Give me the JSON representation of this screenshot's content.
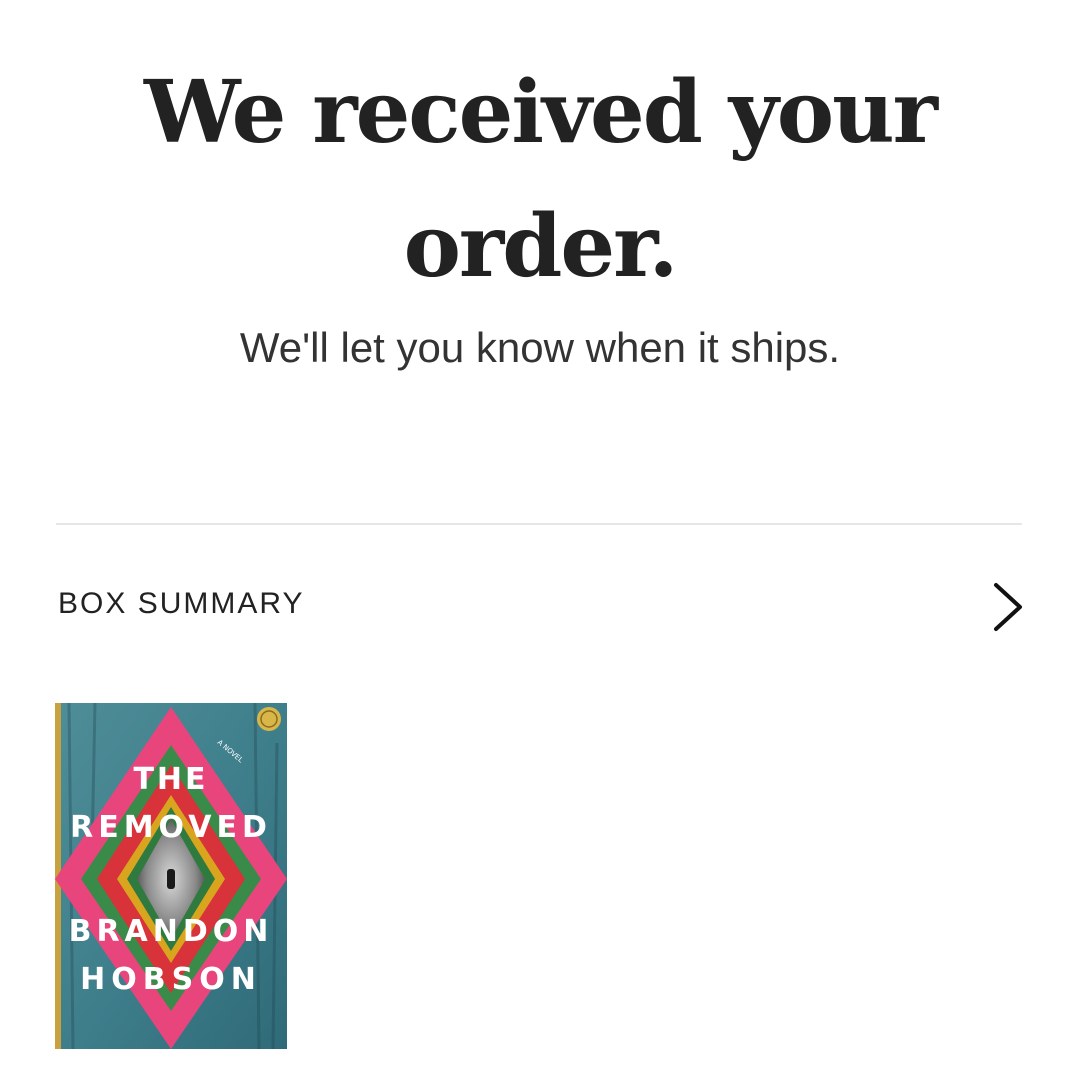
{
  "confirmation": {
    "title_line1": "We received your",
    "title_line2": "order.",
    "subtitle": "We'll let you know when it ships."
  },
  "box_summary": {
    "label": "BOX SUMMARY",
    "chevron_icon": "chevron-right-icon"
  },
  "books": [
    {
      "cover_title_line1": "THE",
      "cover_title_line2": "REMOVED",
      "cover_author_line1": "BRANDON",
      "cover_author_line2": "HOBSON",
      "cover_tagline": "A NOVEL",
      "badge_icon": "book-of-the-month-badge-icon"
    }
  ],
  "colors": {
    "text": "#222222",
    "divider": "#e6e6e6",
    "cover_teal": "#3f7f8c",
    "cover_pink": "#e8457d",
    "cover_red": "#d8323a",
    "cover_gold": "#d9a51f",
    "cover_green": "#3a8a4a",
    "badge_gold": "#d8b64a"
  }
}
